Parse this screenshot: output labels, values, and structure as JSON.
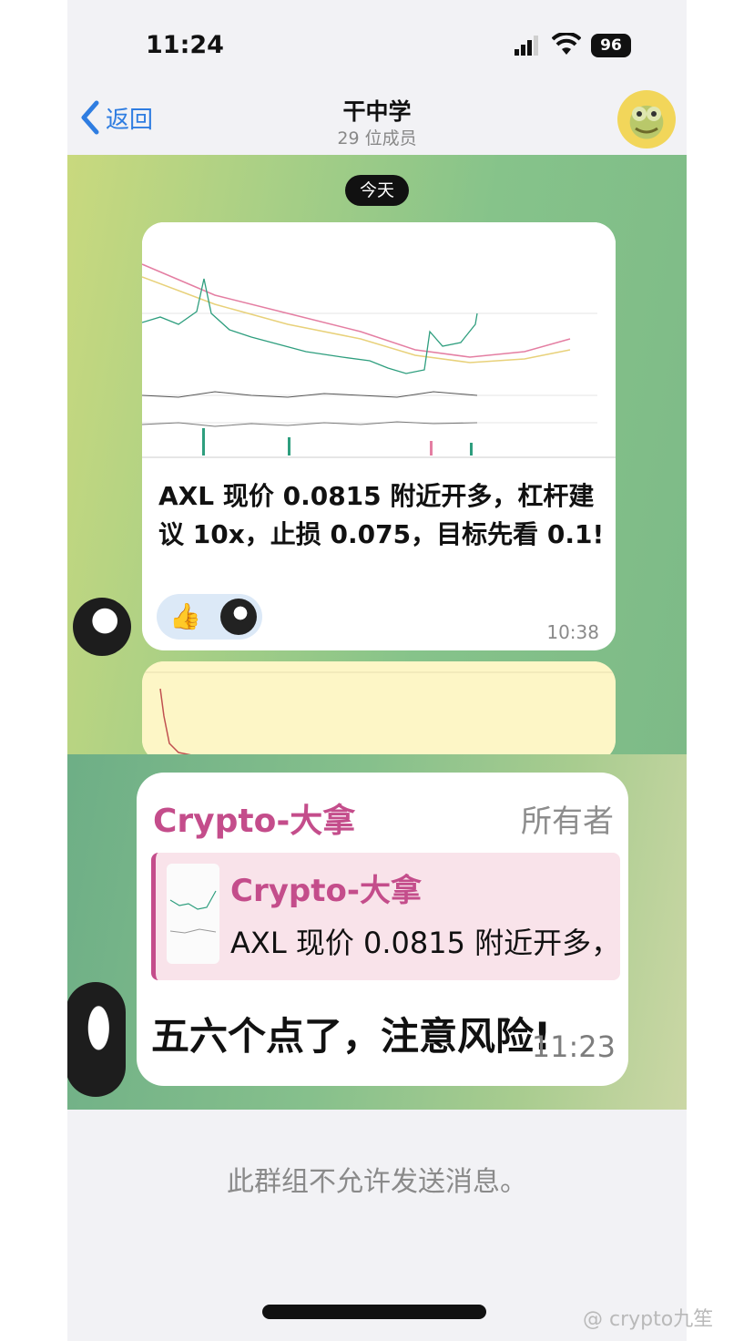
{
  "status_bar": {
    "time": "11:24",
    "battery": "96"
  },
  "header": {
    "back_label": "返回",
    "title": "干中学",
    "subtitle": "29 位成员"
  },
  "chat": {
    "date_label": "今天",
    "message1": {
      "text": "AXL 现价 0.0815 附近开多，杠杆建议 10x，止损 0.075，目标先看 0.1!",
      "time": "10:38",
      "reaction": "👍"
    },
    "message2": {
      "sender": "Crypto-大拿",
      "role": "所有者",
      "reply_sender": "Crypto-大拿",
      "reply_text": "AXL 现价 0.0815 附近开多，杠杆...",
      "text": "五六个点了，注意风险!",
      "time": "11:23"
    }
  },
  "footer": {
    "note": "此群组不允许发送消息。"
  },
  "watermark": "@ crypto九笙",
  "colors": {
    "accent": "#2f7de1",
    "sender": "#c44d8b"
  }
}
